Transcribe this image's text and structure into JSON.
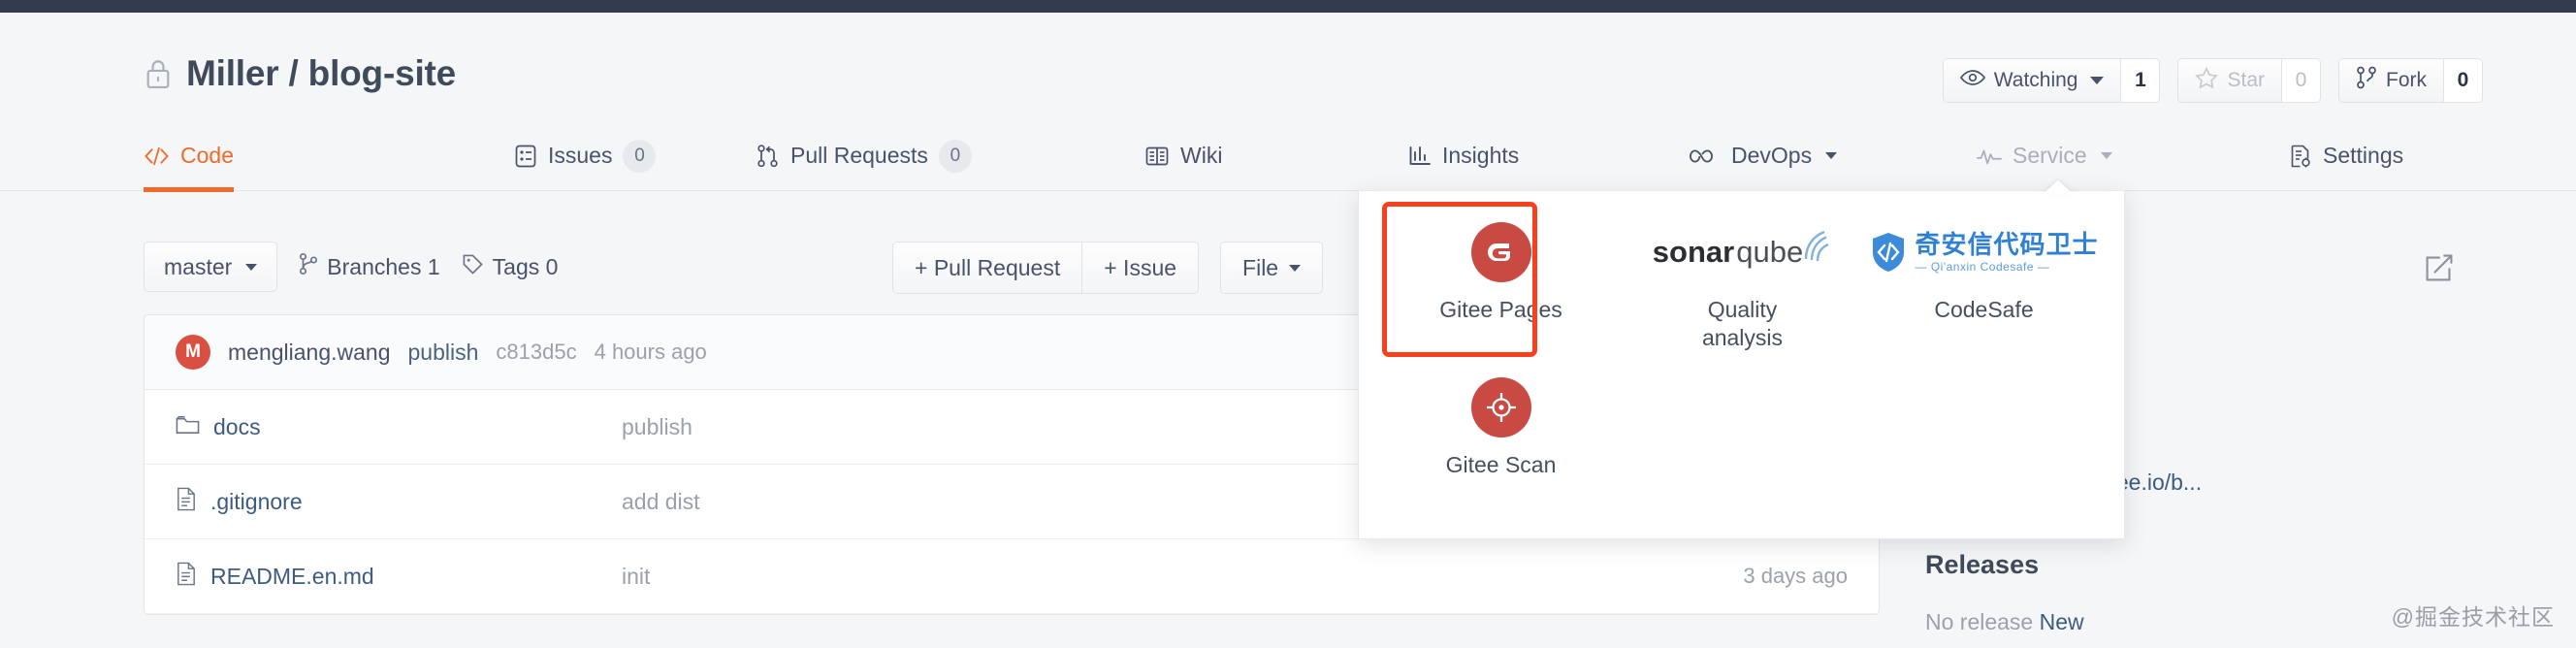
{
  "header": {
    "repo_owner": "Miller",
    "repo_separator": "/",
    "repo_name": "blog-site",
    "repo_full_title": "Miller / blog-site",
    "lock_icon": "lock-icon",
    "actions": {
      "watching_label": "Watching",
      "watching_count": "1",
      "star_label": "Star",
      "star_count": "0",
      "fork_label": "Fork",
      "fork_count": "0"
    }
  },
  "nav": {
    "tabs": [
      {
        "label": "Code",
        "icon": "code-brackets-icon",
        "count": null,
        "active": true,
        "dropdown": false,
        "dim": false
      },
      {
        "label": "Issues",
        "icon": "issues-list-icon",
        "count": "0",
        "active": false,
        "dropdown": false,
        "dim": false
      },
      {
        "label": "Pull Requests",
        "icon": "pull-request-icon",
        "count": "0",
        "active": false,
        "dropdown": false,
        "dim": false
      },
      {
        "label": "Wiki",
        "icon": "wiki-book-icon",
        "count": null,
        "active": false,
        "dropdown": false,
        "dim": false
      },
      {
        "label": "Insights",
        "icon": "insights-bar-icon",
        "count": null,
        "active": false,
        "dropdown": false,
        "dim": false
      },
      {
        "label": "DevOps",
        "icon": "infinity-icon",
        "count": null,
        "active": false,
        "dropdown": true,
        "dim": false
      },
      {
        "label": "Service",
        "icon": "pulse-wave-icon",
        "count": null,
        "active": false,
        "dropdown": true,
        "dim": true
      },
      {
        "label": "Settings",
        "icon": "settings-doc-icon",
        "count": null,
        "active": false,
        "dropdown": false,
        "dim": false
      }
    ]
  },
  "toolbar": {
    "branch_label": "master",
    "branches_label": "Branches 1",
    "tags_label": "Tags 0",
    "pull_request_label": "+ Pull Request",
    "issue_label": "+ Issue",
    "file_label": "File",
    "edit_icon": "edit-square-icon"
  },
  "commit": {
    "avatar_initial": "M",
    "author": "mengliang.wang",
    "message": "publish",
    "sha": "c813d5c",
    "time": "4 hours ago"
  },
  "files": {
    "rows": [
      {
        "icon": "folder-icon",
        "name": "docs",
        "message": "publish",
        "time": ""
      },
      {
        "icon": "file-text-icon",
        "name": ".gitignore",
        "message": "add dist",
        "time": ""
      },
      {
        "icon": "file-text-icon",
        "name": "README.en.md",
        "message": "init",
        "time": "3 days ago"
      }
    ]
  },
  "sidebar": {
    "pages_url": "ps://miller_wang.gitee.io/b...",
    "releases_heading": "Releases",
    "no_release_text": "No release",
    "new_release_link": "New"
  },
  "service_panel": {
    "items": [
      {
        "label": "Gitee Pages",
        "icon": "gitee-logo-icon",
        "highlighted": true
      },
      {
        "label": "Quality\nanalysis",
        "icon": "sonarqube-logo-icon",
        "highlighted": false
      },
      {
        "label": "CodeSafe",
        "icon": "codesafe-logo-icon",
        "highlighted": false
      },
      {
        "label": "Gitee Scan",
        "icon": "gitee-scan-icon",
        "highlighted": false
      }
    ],
    "sonarqube_text_bold": "sonar",
    "sonarqube_text_light": "qube",
    "codesafe_cn": "奇安信代码卫士",
    "codesafe_en": "— Qi'anxin Codesafe —",
    "highlight_color": "#f6401e"
  },
  "watermark": {
    "text": "@掘金技术社区"
  },
  "colors": {
    "accent": "#f06b29",
    "topbar": "#333c4e",
    "link": "#3d5a80",
    "muted": "#9aa1ad",
    "page_bg": "#f5f6f7",
    "highlight": "#f6401e"
  }
}
